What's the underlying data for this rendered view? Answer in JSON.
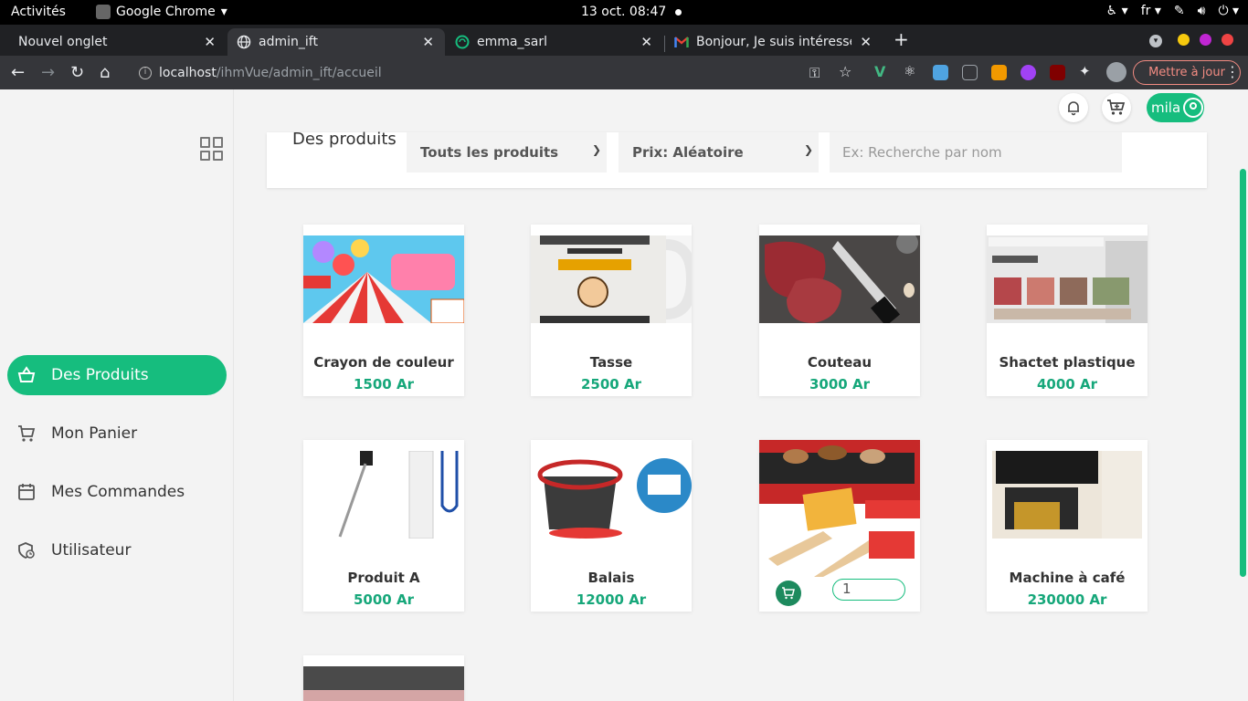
{
  "system_bar": {
    "activities": "Activités",
    "app_name": "Google Chrome",
    "clock": "13 oct.  08:47",
    "language": "fr"
  },
  "tabs": [
    {
      "label": "Nouvel onglet",
      "active": false
    },
    {
      "label": "admin_ift",
      "active": true
    },
    {
      "label": "emma_sarl",
      "active": false
    },
    {
      "label": "Bonjour, Je suis intéressé",
      "active": false
    }
  ],
  "address": {
    "host": "localhost",
    "path": "/ihmVue/admin_ift/accueil"
  },
  "update_button": "Mettre à jour",
  "user": {
    "name": "mila"
  },
  "sidebar": {
    "items": [
      {
        "label": "Des Produits",
        "icon": "basket-icon",
        "active": true
      },
      {
        "label": "Mon Panier",
        "icon": "cart-icon",
        "active": false
      },
      {
        "label": "Mes Commandes",
        "icon": "calendar-icon",
        "active": false
      },
      {
        "label": "Utilisateur",
        "icon": "user-clock-icon",
        "active": false
      }
    ]
  },
  "filters": {
    "title": "Des produits",
    "category_select": "Touts les produits",
    "price_select": "Prix: Aléatoire",
    "search_placeholder": "Ex: Recherche par nom"
  },
  "products": [
    {
      "name": "Crayon de couleur",
      "price": "1500 Ar"
    },
    {
      "name": "Tasse",
      "price": "2500 Ar"
    },
    {
      "name": "Couteau",
      "price": "3000 Ar"
    },
    {
      "name": "Shactet plastique",
      "price": "4000 Ar"
    },
    {
      "name": "Produit A",
      "price": "5000 Ar"
    },
    {
      "name": "Balais",
      "price": "12000 Ar"
    },
    {
      "name": "",
      "price": "",
      "quantity": "1"
    },
    {
      "name": "Machine à café",
      "price": "230000 Ar"
    }
  ]
}
